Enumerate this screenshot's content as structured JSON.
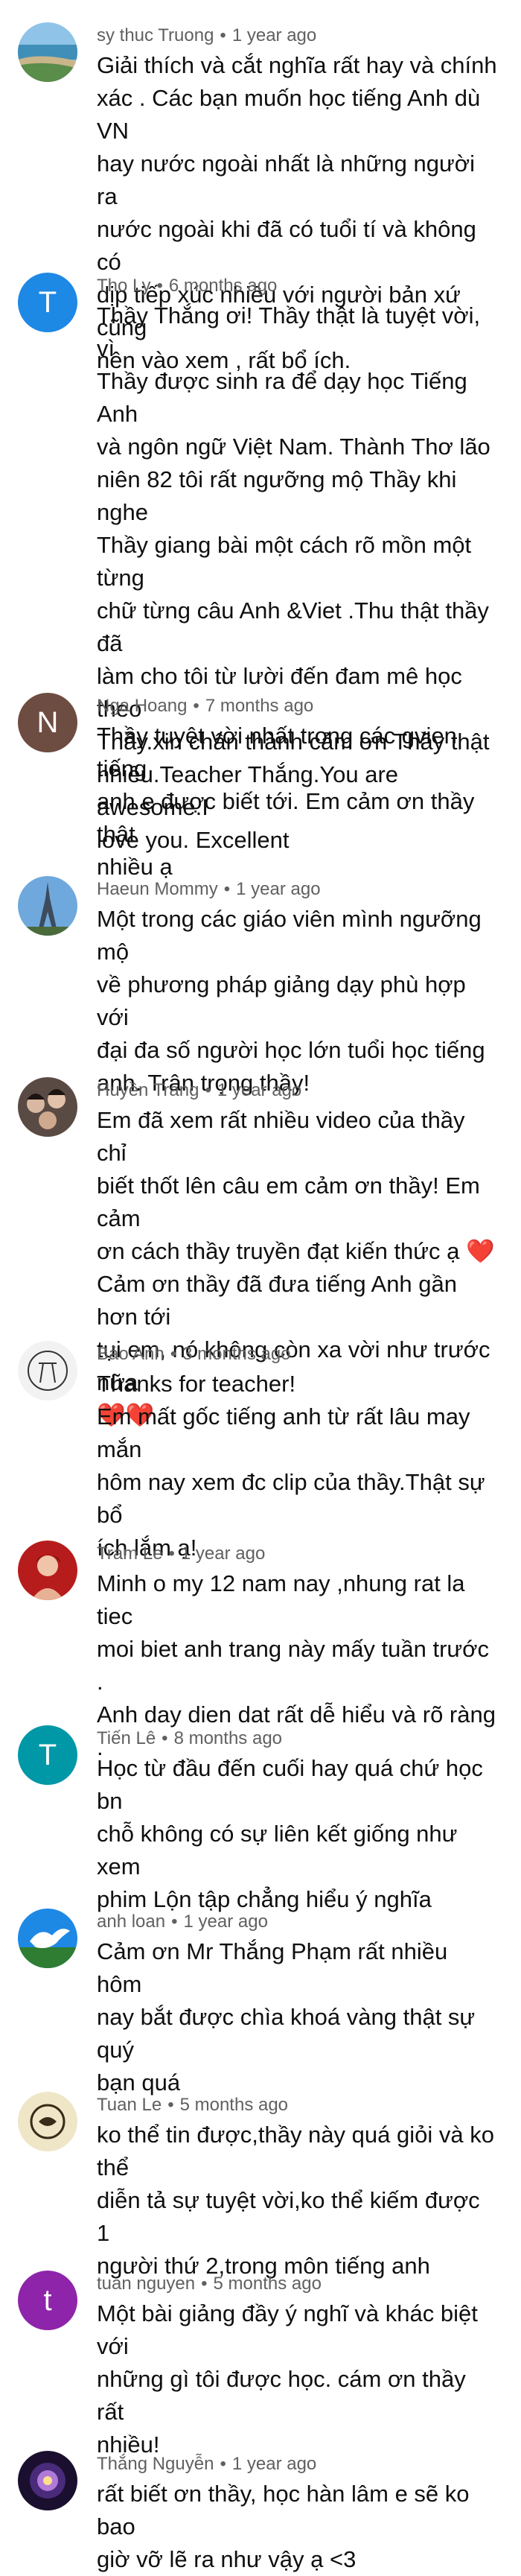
{
  "comments": [
    {
      "author": "sy thuc Truong",
      "time": "1 year ago",
      "avatar_type": "image",
      "avatar_icon": "beach-landscape-icon",
      "text": "Giải thích và cắt nghĩa rất hay và chính\nxác . Các bạn muốn học tiếng Anh dù VN\nhay nước ngoài nhất là những người ra\nnước ngoài khi đã có tuổi tí và không có\ndịp tiếp xúc nhiều với người bản xứ cũng\nnên vào xem , rất bổ ích."
    },
    {
      "author": "Tho Ly",
      "time": "6 months ago",
      "avatar_type": "letter",
      "avatar_letter": "T",
      "avatar_color": "#1e88e5",
      "text": "Thầy Thắng ơi! Thầy thật là tuyệt vời, vì\nThầy được sinh ra để dạy học Tiếng Anh\nvà ngôn ngữ Việt Nam. Thành Thơ lão\nniên 82 tôi rất ngưỡng mộ Thầy khi nghe\nThầy giang bài một cách rõ mồn một từng\nchữ từng câu Anh &Viet .Thu thật thầy đã\nlàm cho tôi từ lười đến đam mê học theo\nThầy.xin chân thành cảm ơn Thầy thật\nnhiều.Teacher Thắng.You are awesome.I\nlove you. Excellent"
    },
    {
      "author": "Nga Hoang",
      "time": "7 months ago",
      "avatar_type": "letter",
      "avatar_letter": "N",
      "avatar_color": "#6d4c41",
      "text": "Thầy tuyệt vời nhất trong các gvien tiếng\nanh e được biết tới. Em cảm ơn thầy thật\nnhiều ạ"
    },
    {
      "author": "Haeun Mommy",
      "time": "1 year ago",
      "avatar_type": "image",
      "avatar_icon": "eiffel-tower-icon",
      "text": "Một trong các giáo viên mình ngưỡng mộ\nvề phương pháp giảng dạy phù hợp với\nđại đa số người học lớn tuổi học tiếng\nanh. Trân trọng thầy!"
    },
    {
      "author": "Huyền Trang",
      "time": "1 year ago",
      "avatar_type": "image",
      "avatar_icon": "group-photo-icon",
      "text": "Em đã xem rất nhiều video của thầy chỉ\nbiết thốt lên câu em cảm ơn thầy! Em cảm\nơn cách thầy truyền đạt kiến thức ạ ❤️\nCảm ơn thầy đã đưa tiếng Anh gần hơn tới\ntụi em, nó không còn xa vời như trước nữa\n❤️❤️"
    },
    {
      "author": "Bảo Anh",
      "time": "3 months ago",
      "avatar_type": "image",
      "avatar_icon": "sketch-drawing-icon",
      "text": "Thanks for teacher!\nEm mất gốc tiếng anh từ rất lâu may mắn\nhôm nay xem đc clip của thầy.Thật sự bổ\ních lắm ạ!"
    },
    {
      "author": "Tram Le",
      "time": "1 year ago",
      "avatar_type": "image",
      "avatar_icon": "portrait-photo-icon",
      "text": "Minh o my 12 nam nay ,nhung rat la tiec\nmoi biet anh trang này mấy tuần trước .\nAnh day dien dat rất dễ hiểu và rõ ràng ."
    },
    {
      "author": "Tiến Lê",
      "time": "8 months ago",
      "avatar_type": "letter",
      "avatar_letter": "T",
      "avatar_color": "#0097a7",
      "text": "Học từ đầu đến cuối hay quá chứ học bn\nchỗ không có sự liên kết giống như xem\nphim Lộn tập chẳng hiểu ý nghĩa"
    },
    {
      "author": "anh loan",
      "time": "1 year ago",
      "avatar_type": "image",
      "avatar_icon": "dove-icon",
      "text": "Cảm ơn Mr Thắng Phạm rất nhiều hôm\nnay bắt được chìa khoá vàng thật sự quý\nbạn quá"
    },
    {
      "author": "Tuan Le",
      "time": "5 months ago",
      "avatar_type": "image",
      "avatar_icon": "logo-badge-icon",
      "text": "ko thể tin được,thầy này quá giỏi và ko thể\ndiễn tả sự tuyệt vời,ko thể kiếm được 1\nngười thứ 2,trong môn tiếng anh"
    },
    {
      "author": "tuan nguyen",
      "time": "5 months ago",
      "avatar_type": "letter",
      "avatar_letter": "t",
      "avatar_color": "#8e24aa",
      "text": "Một bài giảng đầy ý nghĩ và khác biệt với\nnhững gì tôi được học. cám ơn thầy rất\nnhiều!"
    },
    {
      "author": "Thắng Nguyễn",
      "time": "1 year ago",
      "avatar_type": "image",
      "avatar_icon": "galaxy-art-icon",
      "text": "rất biết ơn thầy, học hàn lâm e sẽ ko bao\ngiờ vỡ lẽ ra như vậy ạ <3"
    }
  ],
  "separator": "•"
}
